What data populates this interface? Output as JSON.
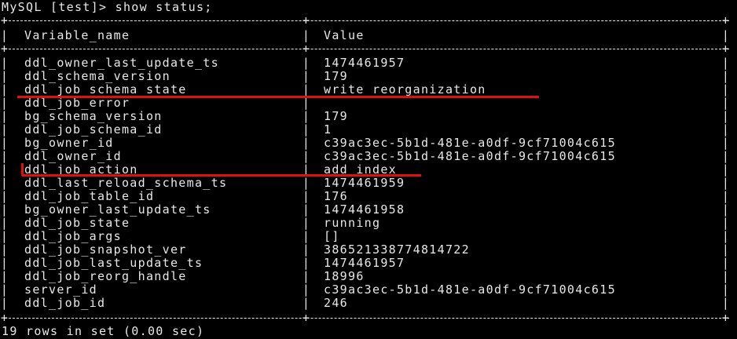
{
  "prompt_line": "MySQL [test]> show status;",
  "headers": {
    "col1": "Variable_name",
    "col2": "Value"
  },
  "rows": [
    {
      "name": "ddl_owner_last_update_ts",
      "value": "1474461957"
    },
    {
      "name": "ddl_schema_version",
      "value": "179"
    },
    {
      "name": "ddl_job_schema_state",
      "value": "write reorganization"
    },
    {
      "name": "ddl_job_error",
      "value": ""
    },
    {
      "name": "bg_schema_version",
      "value": "179"
    },
    {
      "name": "ddl_job_schema_id",
      "value": "1"
    },
    {
      "name": "bg_owner_id",
      "value": "c39ac3ec-5b1d-481e-a0df-9cf71004c615"
    },
    {
      "name": "ddl_owner_id",
      "value": "c39ac3ec-5b1d-481e-a0df-9cf71004c615"
    },
    {
      "name": "ddl_job_action",
      "value": "add index"
    },
    {
      "name": "ddl_last_reload_schema_ts",
      "value": "1474461959"
    },
    {
      "name": "ddl_job_table_id",
      "value": "176"
    },
    {
      "name": "bg_owner_last_update_ts",
      "value": "1474461958"
    },
    {
      "name": "ddl_job_state",
      "value": "running"
    },
    {
      "name": "ddl_job_args",
      "value": "[]"
    },
    {
      "name": "ddl_job_snapshot_ver",
      "value": "386521338774814722"
    },
    {
      "name": "ddl_job_last_update_ts",
      "value": "1474461957"
    },
    {
      "name": "ddl_job_reorg_handle",
      "value": "18996"
    },
    {
      "name": "server_id",
      "value": "c39ac3ec-5b1d-481e-a0df-9cf71004c615"
    },
    {
      "name": "ddl_job_id",
      "value": "246"
    }
  ],
  "result_line": "19 rows in set (0.00 sec)",
  "colors": {
    "text": "#e8e8e8",
    "background": "#000000",
    "highlight": "#e01010"
  },
  "highlighted_rows": [
    "ddl_job_schema_state",
    "ddl_job_action"
  ]
}
